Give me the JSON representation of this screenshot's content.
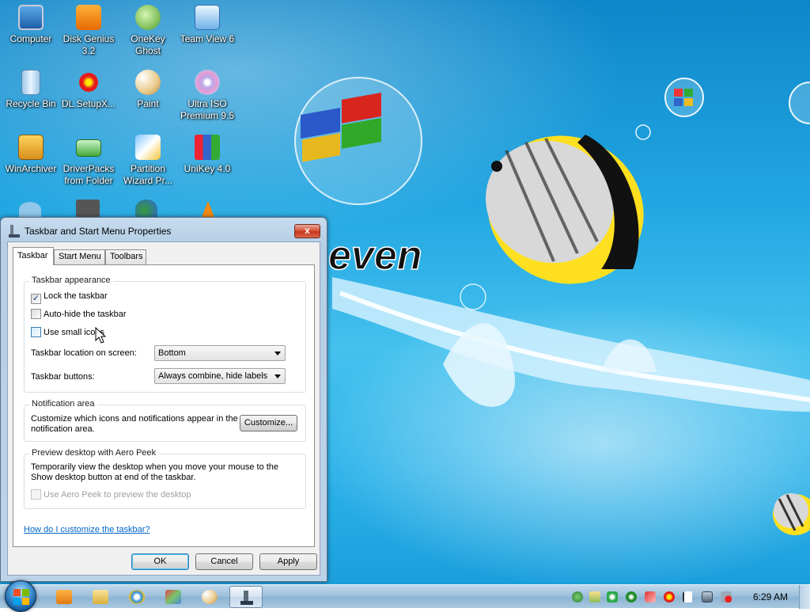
{
  "desktop": {
    "wallpaper_text": "even",
    "icons": [
      {
        "label": "Computer"
      },
      {
        "label": "Disk Genius 3.2"
      },
      {
        "label": "OneKey Ghost"
      },
      {
        "label": "Team View 6"
      },
      {
        "label": "Recycle Bin"
      },
      {
        "label": "DL.SetupX..."
      },
      {
        "label": "Paint"
      },
      {
        "label": "Ultra ISO Premium 9.5"
      },
      {
        "label": "WinArchiver"
      },
      {
        "label": "DriverPacks from Folder"
      },
      {
        "label": "Partition Wizard Pr..."
      },
      {
        "label": "UniKey 4.0"
      }
    ]
  },
  "dialog": {
    "title": "Taskbar and Start Menu Properties",
    "close_label": "x",
    "tabs": [
      {
        "label": "Taskbar",
        "active": true
      },
      {
        "label": "Start Menu",
        "active": false
      },
      {
        "label": "Toolbars",
        "active": false
      }
    ],
    "appearance": {
      "title": "Taskbar appearance",
      "lock": {
        "label": "Lock the taskbar",
        "checked": true
      },
      "autohide": {
        "label": "Auto-hide the taskbar",
        "checked": false
      },
      "small_icons": {
        "label": "Use small icons",
        "checked": false
      },
      "location_label": "Taskbar location on screen:",
      "location_value": "Bottom",
      "buttons_label": "Taskbar buttons:",
      "buttons_value": "Always combine, hide labels"
    },
    "notification": {
      "title": "Notification area",
      "desc_line1": "Customize which icons and notifications appear in the",
      "desc_line2": "notification area.",
      "customize_label": "Customize..."
    },
    "aero_peek": {
      "title": "Preview desktop with Aero Peek",
      "desc_line1": "Temporarily view the desktop when you move your mouse to the",
      "desc_line2": "Show desktop button at end of the taskbar.",
      "checkbox_label": "Use Aero Peek to preview the desktop",
      "checked": false,
      "enabled": false
    },
    "help_link": "How do I customize the taskbar?",
    "ok_label": "OK",
    "cancel_label": "Cancel",
    "apply_label": "Apply"
  },
  "taskbar": {
    "clock": "6:29 AM",
    "pinned_icons": [
      "media-player-icon",
      "explorer-folder-icon",
      "internet-explorer-icon",
      "tool-icon",
      "paint-icon",
      "properties-window-icon"
    ]
  },
  "colors": {
    "accent": "#3c7fb1",
    "link": "#0066cc",
    "close_red": "#c7361c"
  }
}
